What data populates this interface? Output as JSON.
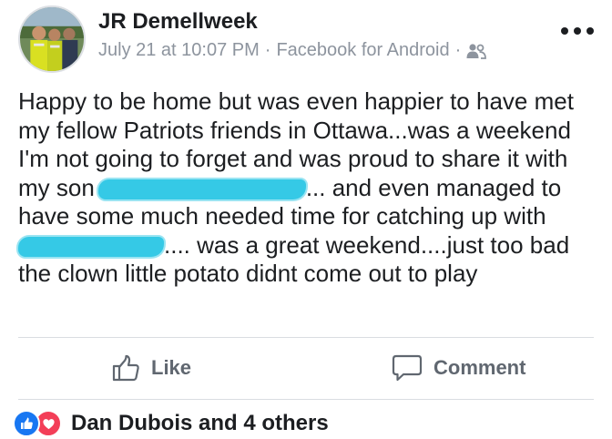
{
  "post": {
    "author": "JR Demellweek",
    "timestamp": "July 21 at 10:07 PM",
    "separator": "·",
    "source": "Facebook for Android",
    "audience_icon": "friends-icon",
    "more_icon": "more-dots-icon",
    "text_lines": [
      {
        "before": "Happy to be home but was even happier to have met",
        "after": ""
      },
      {
        "before": "my fellow Patriots friends in Ottawa...was a weekend",
        "after": ""
      },
      {
        "before": "I'm not going to forget and was proud to share it with",
        "after": ""
      },
      {
        "before": "my son",
        "after": "... and even managed to"
      },
      {
        "before": "have some much needed time for catching up with",
        "after": ""
      },
      {
        "before": "",
        "after": ".... was a great weekend....just too bad"
      },
      {
        "before": "the clown little potato didnt come out to play",
        "after": ""
      }
    ]
  },
  "actions": {
    "like_label": "Like",
    "like_icon": "thumbs-up-outline-icon",
    "comment_label": "Comment",
    "comment_icon": "comment-bubble-icon"
  },
  "reactions": {
    "icons": [
      "like-reaction-icon",
      "love-reaction-icon"
    ],
    "summary": "Dan Dubois and 4 others"
  },
  "colors": {
    "redaction": "#35c9e6",
    "like_blue": "#1877f2",
    "love_red": "#f33e58",
    "muted_text": "#8d949e",
    "action_text": "#606770"
  }
}
